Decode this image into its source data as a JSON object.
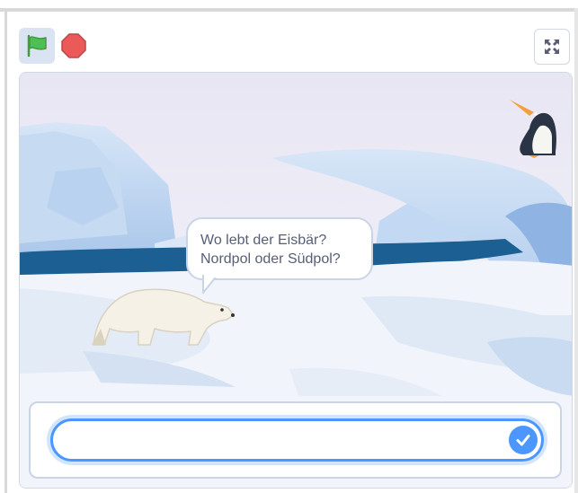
{
  "controls": {
    "green_flag_icon": "green-flag-icon",
    "stop_icon": "stop-sign-icon",
    "fullscreen_icon": "fullscreen-expand-icon"
  },
  "stage": {
    "backdrop": "arctic",
    "sprites": [
      "polar-bear",
      "penguin"
    ],
    "speech_bubble": {
      "line1": "Wo lebt der Eisbär?",
      "line2": "Nordpol oder Südpol?"
    }
  },
  "ask": {
    "value": "",
    "placeholder": "",
    "submit_icon": "checkmark-icon"
  },
  "colors": {
    "accent": "#4c97ff",
    "flag_green": "#4cbf56",
    "stop_red": "#ec5959",
    "text": "#575e75"
  }
}
